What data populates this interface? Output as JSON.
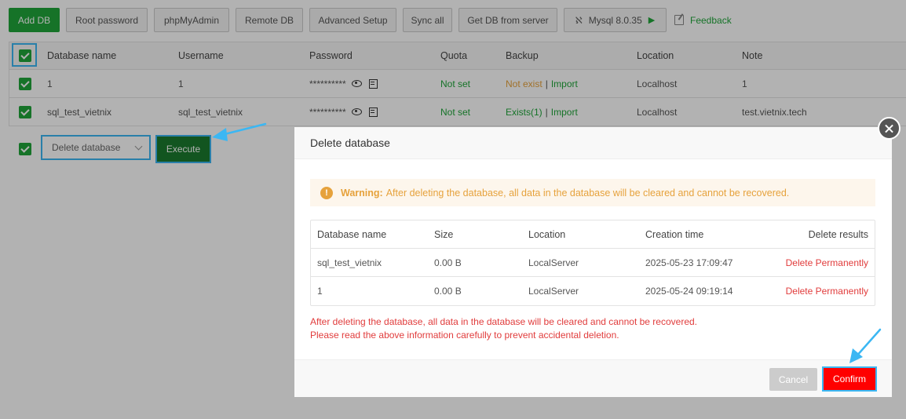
{
  "toolbar": {
    "add_db": "Add DB",
    "root_password": "Root password",
    "phpmyadmin": "phpMyAdmin",
    "remote_db": "Remote DB",
    "advanced_setup": "Advanced Setup",
    "sync_all": "Sync all",
    "get_db_from_server": "Get DB from server",
    "mysql_version": "Mysql 8.0.35",
    "feedback": "Feedback"
  },
  "table": {
    "columns": [
      "Database name",
      "Username",
      "Password",
      "Quota",
      "Backup",
      "Location",
      "Note"
    ],
    "rows": [
      {
        "name": "1",
        "username": "1",
        "password": "**********",
        "quota": "Not set",
        "backup_status": "Not exist",
        "backup_sep": "|",
        "backup_import": "Import",
        "location": "Localhost",
        "note": "1"
      },
      {
        "name": "sql_test_vietnix",
        "username": "sql_test_vietnix",
        "password": "**********",
        "quota": "Not set",
        "backup_status": "Exists(1)",
        "backup_sep": "|",
        "backup_import": "Import",
        "location": "Localhost",
        "note": "test.vietnix.tech"
      }
    ]
  },
  "batch": {
    "selected_action": "Delete database",
    "execute": "Execute"
  },
  "modal": {
    "title": "Delete database",
    "warning_label": "Warning:",
    "warning_text": "After deleting the database, all data in the database will be cleared and cannot be recovered.",
    "columns": [
      "Database name",
      "Size",
      "Location",
      "Creation time",
      "Delete results"
    ],
    "rows": [
      {
        "name": "sql_test_vietnix",
        "size": "0.00 B",
        "location": "LocalServer",
        "created": "2025-05-23 17:09:47",
        "result": "Delete Permanently"
      },
      {
        "name": "1",
        "size": "0.00 B",
        "location": "LocalServer",
        "created": "2025-05-24 09:19:14",
        "result": "Delete Permanently"
      }
    ],
    "tip_line1": "After deleting the database, all data in the database will be cleared and cannot be recovered.",
    "tip_line2": "Please read the above information carefully to prevent accidental deletion.",
    "cancel": "Cancel",
    "confirm": "Confirm"
  },
  "colors": {
    "accent_green": "#20a53a",
    "danger_red": "#ff0000",
    "highlight_blue": "#3bb7f3",
    "warning_orange": "#e6a23c"
  }
}
